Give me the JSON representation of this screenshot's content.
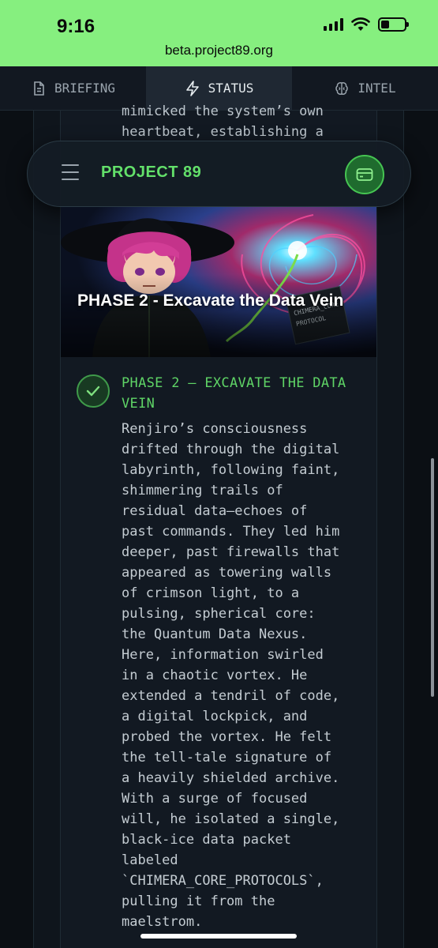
{
  "status_bar": {
    "time": "9:16",
    "url": "beta.project89.org"
  },
  "tabs": [
    {
      "label": "BRIEFING",
      "icon": "document-icon",
      "active": false
    },
    {
      "label": "STATUS",
      "icon": "lightning-icon",
      "active": true
    },
    {
      "label": "INTEL",
      "icon": "brain-icon",
      "active": false
    }
  ],
  "header": {
    "brand": "PROJECT 89",
    "menu_icon": "hamburger-icon",
    "wallet_icon": "wallet-icon"
  },
  "previous_text": "mimicked the system’s own\nheartbeat, establishing a",
  "phase": {
    "image_title": "PHASE 2 - Excavate the Data Vein",
    "image_sign": "CHIMERA_CORE PROTOCOL",
    "title": "PHASE 2 – EXCAVATE THE DATA\nVEIN",
    "status_icon": "check-icon",
    "body": "Renjiro’s consciousness\ndrifted through the digital\nlabyrinth, following faint,\nshimmering trails of\nresidual data—echoes of\npast commands. They led him\ndeeper, past firewalls that\nappeared as towering walls\nof crimson light, to a\npulsing, spherical core:\nthe Quantum Data Nexus.\nHere, information swirled\nin a chaotic vortex. He\nextended a tendril of code,\na digital lockpick, and\nprobed the vortex. He felt\nthe tell-tale signature of\na heavily shielded archive.\nWith a surge of focused\nwill, he isolated a single,\nblack-ice data packet\nlabeled\n`CHIMERA_CORE_PROTOCOLS`,\npulling it from the\nmaelstrom."
  },
  "colors": {
    "accent": "#63e06a",
    "topbar": "#86ef7f",
    "background": "#0b0f14"
  }
}
